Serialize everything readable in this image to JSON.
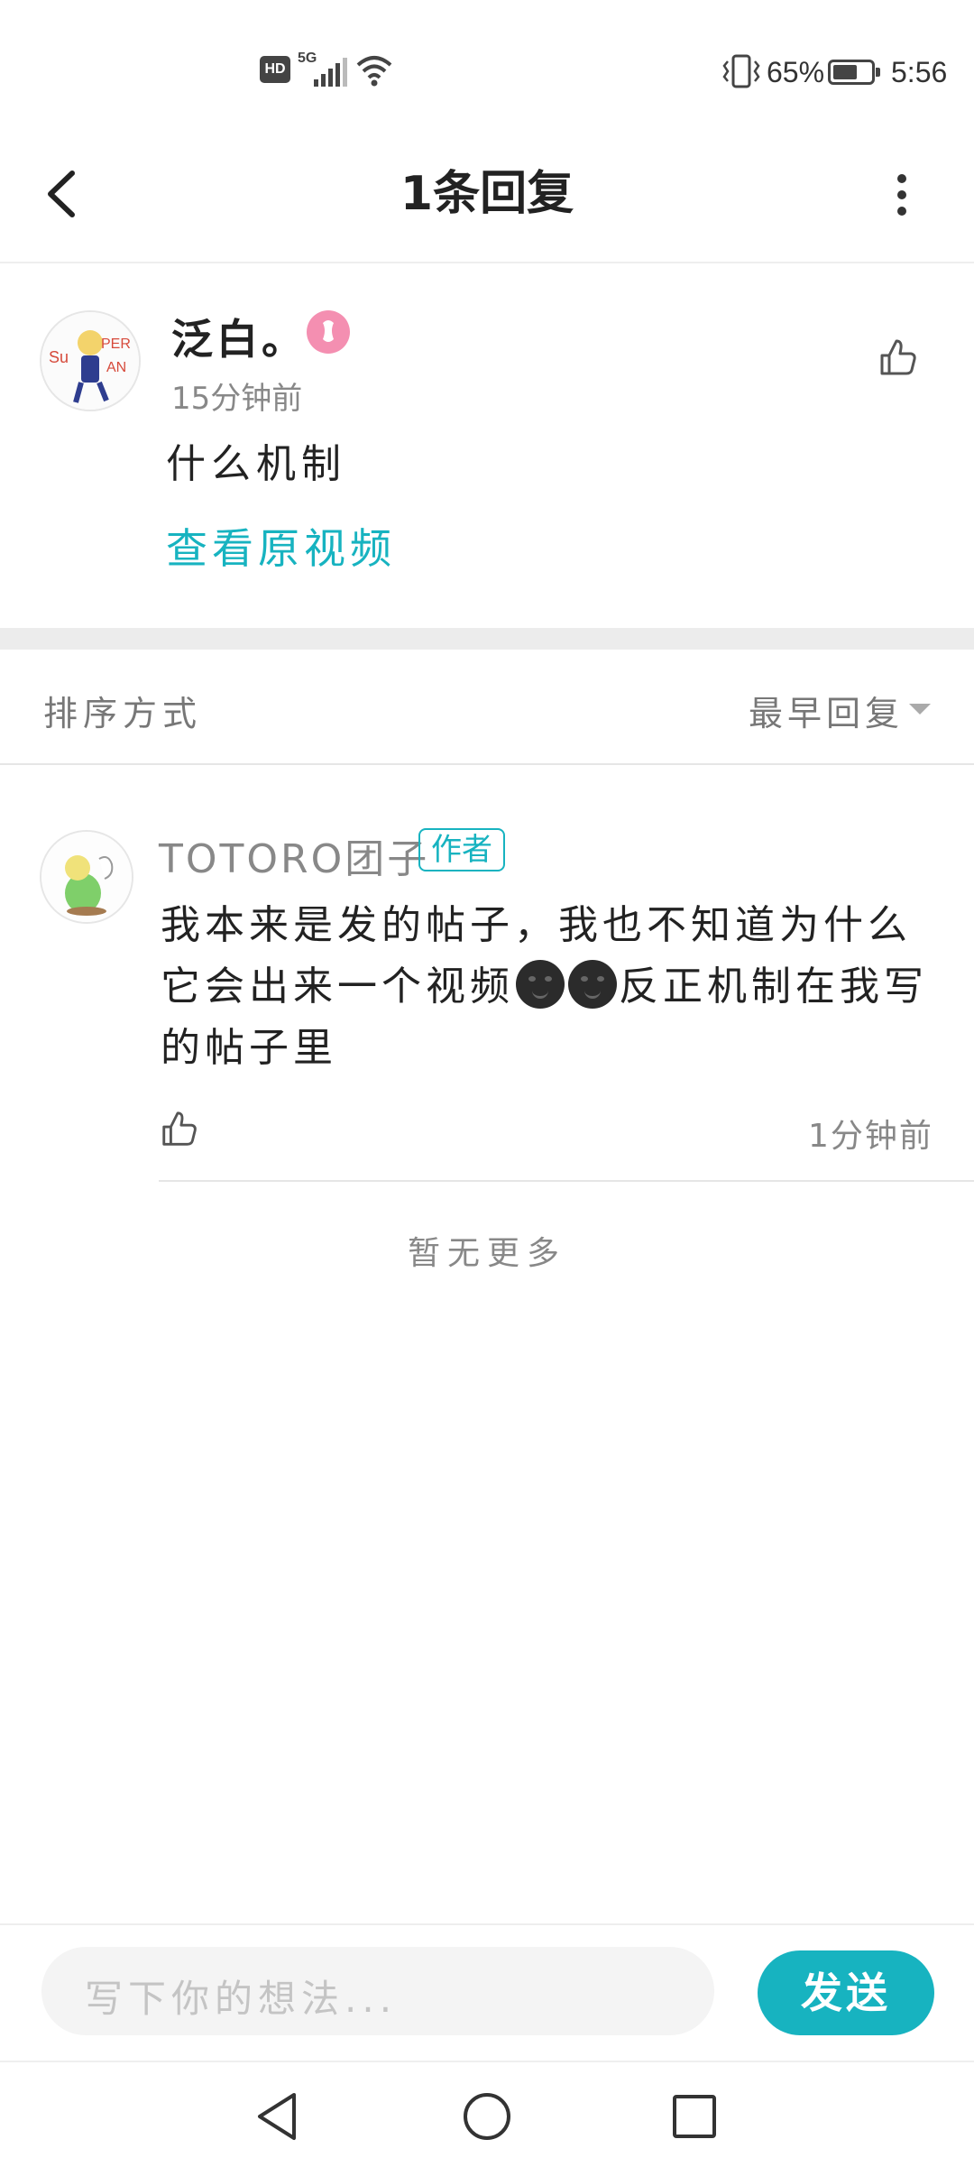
{
  "status_bar": {
    "hd_label": "HD",
    "network": "5G",
    "battery_percent": "65%",
    "battery_level": 0.65,
    "time": "5:56"
  },
  "header": {
    "title": "1条回复"
  },
  "comment": {
    "username": "泛白。",
    "time": "15分钟前",
    "text": "什么机制",
    "view_video_link": "查看原视频"
  },
  "sort": {
    "label": "排序方式",
    "selected": "最早回复"
  },
  "replies": [
    {
      "username": "TOTORO团子",
      "badge": "作者",
      "text_part1": "我本来是发的帖子，我也不知道为什么它会出来一个视频",
      "text_part2": "反正机制在我写的帖子里",
      "time": "1分钟前"
    }
  ],
  "no_more": "暂无更多",
  "input": {
    "placeholder": "写下你的想法..."
  },
  "send_label": "发送",
  "colors": {
    "accent": "#17b3c0"
  }
}
